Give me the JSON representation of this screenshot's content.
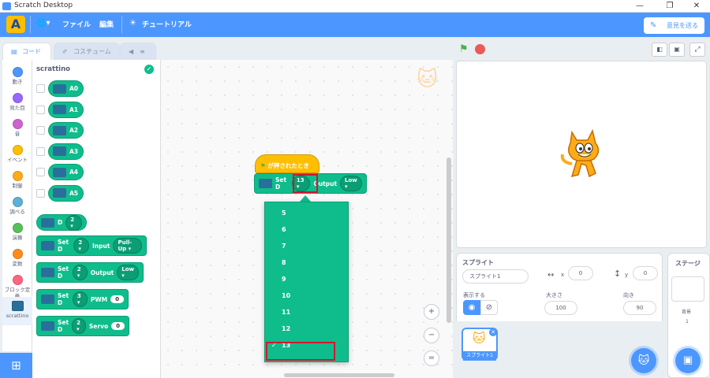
{
  "window": {
    "title": "Scratch Desktop",
    "min": "—",
    "max": "❐",
    "close": "✕"
  },
  "menu": {
    "logo": "A",
    "globe": "🌐▾",
    "file": "ファイル",
    "edit": "編集",
    "tutorial": "チュートリアル",
    "feedback": "意見を送る"
  },
  "tabs": {
    "code": "コード",
    "costume": "コスチューム",
    "sound": "≡"
  },
  "categories": [
    {
      "label": "動き",
      "color": "#4c97ff"
    },
    {
      "label": "見た目",
      "color": "#9966ff"
    },
    {
      "label": "音",
      "color": "#cf63cf"
    },
    {
      "label": "イベント",
      "color": "#ffbf00"
    },
    {
      "label": "制御",
      "color": "#ffab19"
    },
    {
      "label": "調べる",
      "color": "#5cb1d6"
    },
    {
      "label": "演算",
      "color": "#59c059"
    },
    {
      "label": "変数",
      "color": "#ff8c1a"
    },
    {
      "label": "ブロック定義",
      "color": "#ff6680"
    },
    {
      "label": "scrattino",
      "color": "#2a6f9c"
    }
  ],
  "palette": {
    "title": "scrattino",
    "reporters": [
      "A0",
      "A1",
      "A2",
      "A3",
      "A4",
      "A5"
    ],
    "d_block": {
      "label": "D",
      "pin": "2"
    },
    "set_input": {
      "label": "Set D",
      "pin": "2",
      "mode_label": "Input",
      "mode": "Pull-Up"
    },
    "set_output": {
      "label": "Set D",
      "pin": "2",
      "mode_label": "Output",
      "value": "Low"
    },
    "set_pwm": {
      "label": "Set D",
      "pin": "3",
      "mode_label": "PWM",
      "value": "0"
    },
    "set_servo": {
      "label": "Set D",
      "pin": "2",
      "mode_label": "Servo",
      "value": "0"
    }
  },
  "script": {
    "hat": "が押されたとき",
    "set_label": "Set D",
    "pin": "13",
    "output_label": "Output",
    "value": "Low"
  },
  "dropdown": {
    "options": [
      "5",
      "6",
      "7",
      "8",
      "9",
      "10",
      "11",
      "12",
      "13"
    ],
    "selected": "13",
    "check": "✓"
  },
  "zoom": {
    "in": "+",
    "out": "−",
    "reset": "="
  },
  "sprite": {
    "header": "スプライト",
    "name": "スプライト1",
    "x_label": "x",
    "x": "0",
    "y_label": "y",
    "y": "0",
    "show_label": "表示する",
    "size_label": "大きさ",
    "size": "100",
    "direction_label": "向き",
    "direction": "90",
    "thumb_label": "スプライト1"
  },
  "stage_panel": {
    "header": "ステージ",
    "backdrop_label": "背景",
    "backdrop_count": "1"
  }
}
